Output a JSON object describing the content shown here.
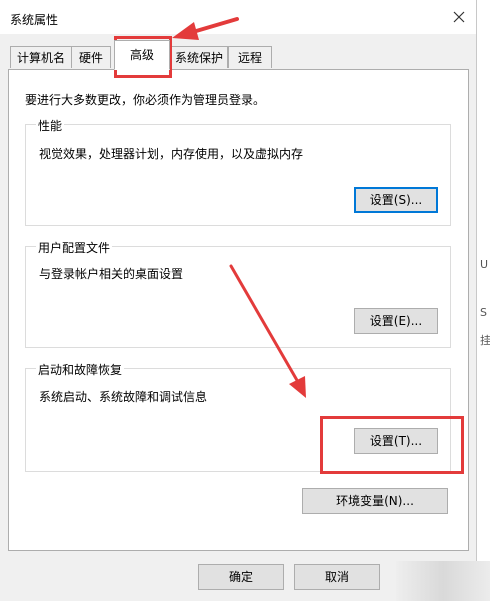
{
  "window": {
    "title": "系统属性",
    "close_icon": "close-icon"
  },
  "tabs": [
    {
      "label": "计算机名",
      "active": false
    },
    {
      "label": "硬件",
      "active": false
    },
    {
      "label": "高级",
      "active": true
    },
    {
      "label": "系统保护",
      "active": false
    },
    {
      "label": "远程",
      "active": false
    }
  ],
  "advanced": {
    "intro": "要进行大多数更改，你必须作为管理员登录。",
    "performance": {
      "label": "性能",
      "description": "视觉效果，处理器计划，内存使用，以及虚拟内存",
      "button": "设置(S)..."
    },
    "user_profiles": {
      "label": "用户配置文件",
      "description": "与登录帐户相关的桌面设置",
      "button": "设置(E)..."
    },
    "startup_recovery": {
      "label": "启动和故障恢复",
      "description": "系统启动、系统故障和调试信息",
      "button": "设置(T)..."
    },
    "env_button": "环境变量(N)..."
  },
  "footer": {
    "ok": "确定",
    "cancel": "取消"
  },
  "side_glyphs": [
    "U",
    "S",
    "挂"
  ],
  "colors": {
    "accent": "#0078d7",
    "annotation": "#e33b3b",
    "dialog_bg": "#f0f0f0"
  }
}
